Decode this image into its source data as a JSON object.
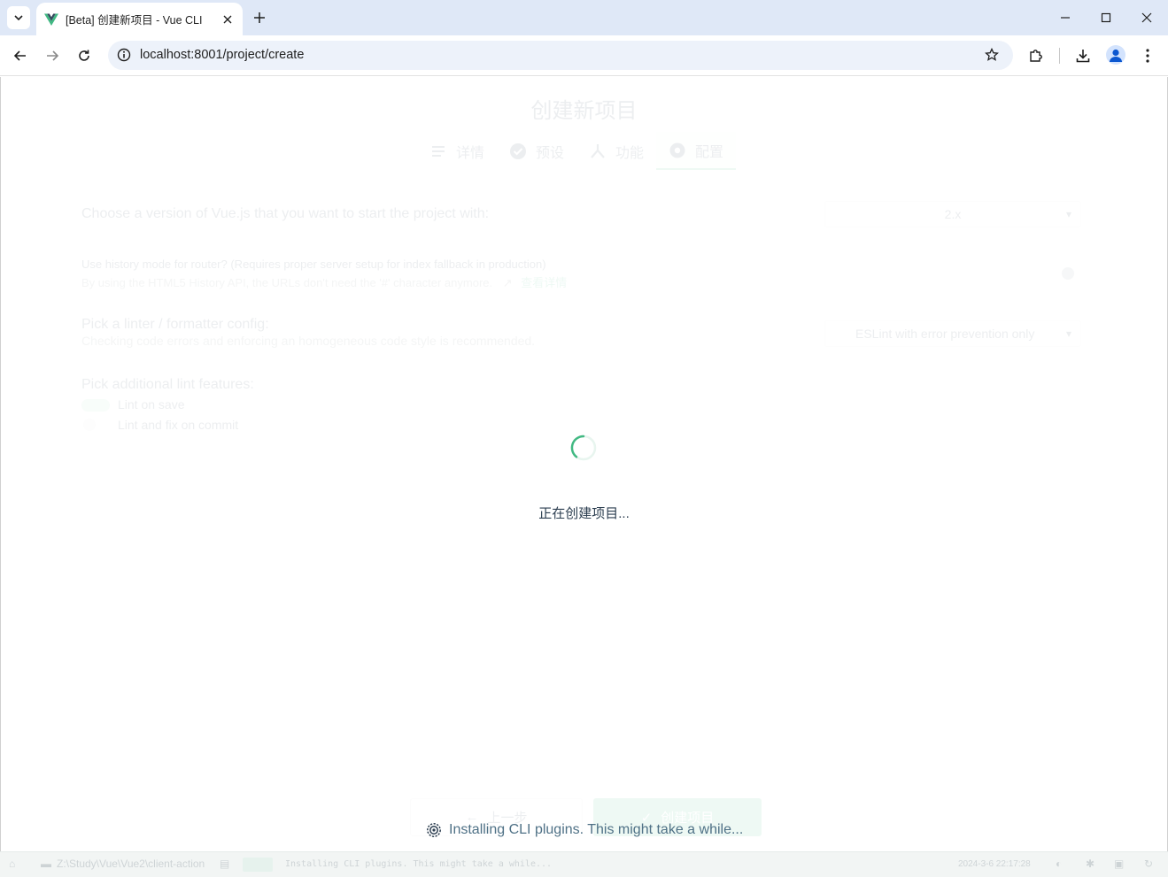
{
  "browser": {
    "tab_title": "[Beta] 创建新项目 - Vue CLI",
    "url": "localhost:8001/project/create",
    "accent": "#42b983"
  },
  "page": {
    "title": "创建新项目",
    "steps": [
      {
        "label": "详情",
        "icon": "list-icon"
      },
      {
        "label": "预设",
        "icon": "check-circle-icon"
      },
      {
        "label": "功能",
        "icon": "fork-icon"
      },
      {
        "label": "配置",
        "icon": "settings-icon"
      }
    ],
    "prompts": {
      "vue_version": {
        "label": "Choose a version of Vue.js that you want to start the project with:",
        "value": "2.x"
      },
      "history_mode": {
        "label": "Use history mode for router? (Requires proper server setup for index fallback in production)",
        "desc": "By using the HTML5 History API, the URLs don't need the '#' character anymore.",
        "link": "查看详情"
      },
      "linter": {
        "label": "Pick a linter / formatter config:",
        "desc": "Checking code errors and enforcing an homogeneous code style is recommended.",
        "value": "ESLint with error prevention only"
      },
      "lint_features": {
        "label": "Pick additional lint features:",
        "options": [
          "Lint on save",
          "Lint and fix on commit"
        ]
      }
    },
    "buttons": {
      "prev": "上一步",
      "create": "创建项目"
    }
  },
  "overlay": {
    "loading_text": "正在创建项目...",
    "status_message": "Installing CLI plugins. This might take a while..."
  },
  "statusbar": {
    "path": "Z:\\Study\\Vue\\Vue2\\client-action",
    "log": "Installing CLI plugins. This might take a while...",
    "time": "2024-3-6 22:17:28"
  }
}
